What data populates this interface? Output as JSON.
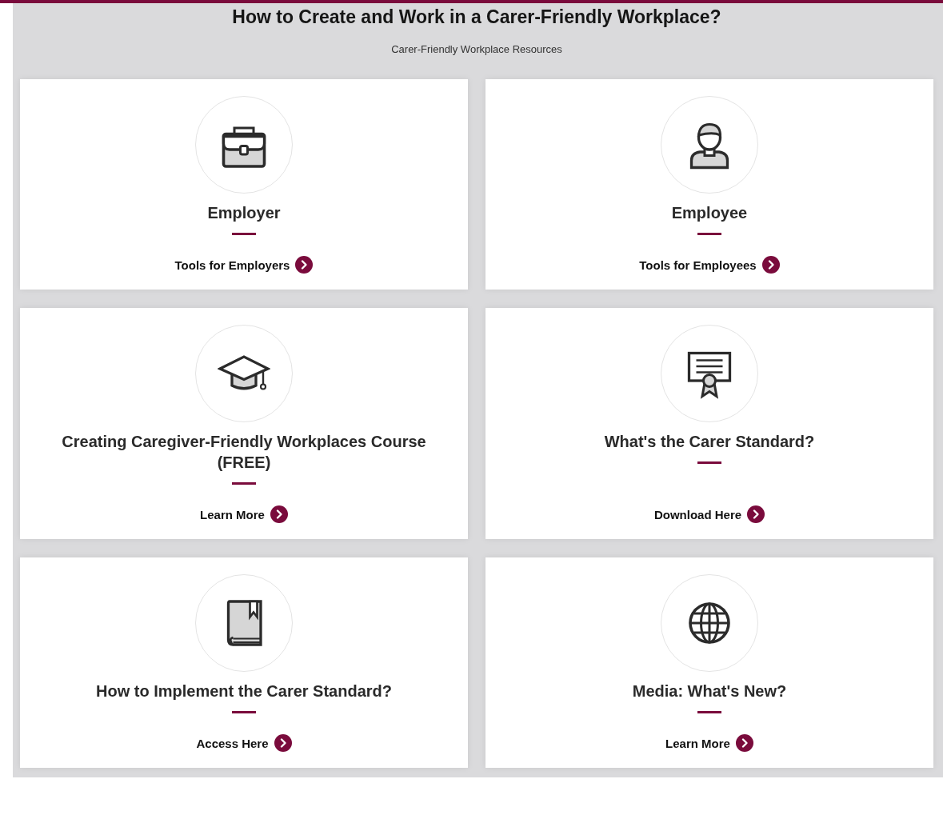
{
  "header": {
    "title": "How to Create and Work in a Carer-Friendly Workplace?",
    "subtitle": "Carer-Friendly Workplace Resources"
  },
  "cards": [
    {
      "title": "Employer",
      "link": "Tools for Employers"
    },
    {
      "title": "Employee",
      "link": "Tools for Employees"
    },
    {
      "title": "Creating Caregiver-Friendly Workplaces Course (FREE)",
      "link": "Learn More"
    },
    {
      "title": "What's the Carer Standard?",
      "link": "Download Here"
    },
    {
      "title": "How to Implement the Carer Standard?",
      "link": "Access Here"
    },
    {
      "title": "Media: What's New?",
      "link": "Learn More"
    }
  ]
}
